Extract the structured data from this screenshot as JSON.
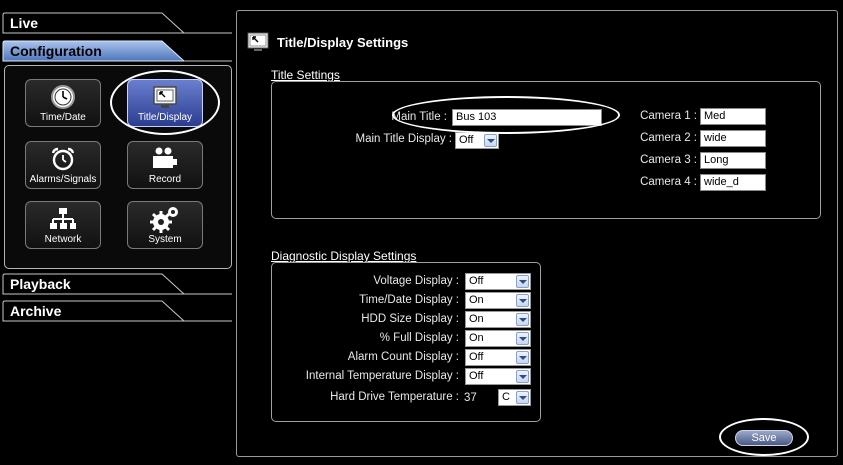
{
  "sidebar": {
    "tabs": {
      "live": "Live",
      "configuration": "Configuration",
      "playback": "Playback",
      "archive": "Archive"
    },
    "config_buttons": [
      {
        "label": "Time/Date",
        "icon": "clock-icon"
      },
      {
        "label": "Title/Display",
        "icon": "monitor-icon"
      },
      {
        "label": "Alarms/Signals",
        "icon": "alarm-clock-icon"
      },
      {
        "label": "Record",
        "icon": "camera-icon"
      },
      {
        "label": "Network",
        "icon": "network-icon"
      },
      {
        "label": "System",
        "icon": "gears-icon"
      }
    ]
  },
  "main": {
    "title": "Title/Display Settings",
    "title_settings": {
      "heading": "Title Settings",
      "main_title_label": "Main Title :",
      "main_title_value": "Bus 103",
      "main_title_display_label": "Main Title Display :",
      "main_title_display_value": "Off",
      "cameras": [
        {
          "label": "Camera 1 :",
          "value": "Med"
        },
        {
          "label": "Camera 2 :",
          "value": "wide"
        },
        {
          "label": "Camera 3 :",
          "value": "Long"
        },
        {
          "label": "Camera 4 :",
          "value": "wide_d"
        }
      ]
    },
    "diagnostic": {
      "heading": "Diagnostic Display Settings",
      "rows": [
        {
          "label": "Voltage Display :",
          "value": "Off"
        },
        {
          "label": "Time/Date Display :",
          "value": "On"
        },
        {
          "label": "HDD Size Display :",
          "value": "On"
        },
        {
          "label": "% Full Display :",
          "value": "On"
        },
        {
          "label": "Alarm Count Display :",
          "value": "Off"
        },
        {
          "label": "Internal Temperature Display :",
          "value": "Off"
        }
      ],
      "hdd_temp_label": "Hard Drive Temperature :",
      "hdd_temp_value": "37",
      "hdd_temp_unit": "C"
    },
    "save_label": "Save"
  },
  "colors": {
    "background": "#000000",
    "selected_button": "#4a5fb8",
    "tab_fill": "#ffffff",
    "tab_fill_active": "#5f86c8"
  }
}
